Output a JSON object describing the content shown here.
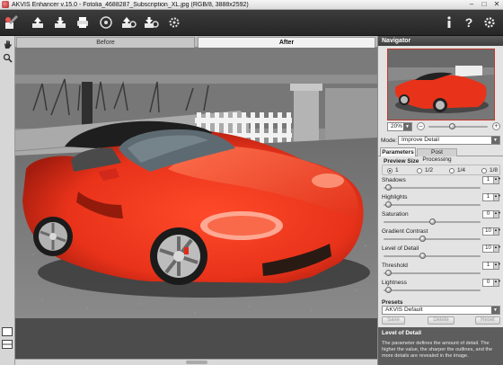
{
  "window": {
    "title": "AKVIS Enhancer v.15.0 - Fotolia_4688287_Subscription_XL.jpg (RGB/8, 3888x2592)",
    "controls": [
      "–",
      "□",
      "✕"
    ]
  },
  "toolbar": {
    "left_icons": [
      "brush-icon",
      "open-icon",
      "save-icon",
      "print-icon",
      "share-icon",
      "batch-icon",
      "batch-run-icon",
      "settings-icon"
    ],
    "right_icons": [
      "info-icon",
      "help-icon",
      "preferences-icon"
    ]
  },
  "left_tools": [
    "hand-icon",
    "zoom-icon",
    "view-mode-single-icon",
    "view-mode-split-icon"
  ],
  "tabs": {
    "before": "Before",
    "after": "After"
  },
  "navigator": {
    "title": "Navigator",
    "zoom": "20%",
    "minus": "–",
    "plus": "+"
  },
  "mode": {
    "label": "Mode:",
    "value": "Improve Detail"
  },
  "param_tabs": {
    "parameters": "Parameters",
    "post_processing": "Post Processing"
  },
  "preview_size": {
    "title": "Preview Size",
    "options": [
      "1",
      "1/2",
      "1/4",
      "1/8"
    ],
    "selected": "1"
  },
  "params": [
    {
      "label": "Shadows",
      "value": "1",
      "level": 0.05
    },
    {
      "label": "Highlights",
      "value": "1",
      "level": 0.05
    },
    {
      "label": "Saturation",
      "value": "0",
      "level": 0.5
    },
    {
      "label": "Gradient Contrast",
      "value": "10",
      "level": 0.4
    },
    {
      "label": "Level of Detail",
      "value": "10",
      "level": 0.4
    },
    {
      "label": "Threshold",
      "value": "1",
      "level": 0.05
    },
    {
      "label": "Lightness",
      "value": "0",
      "level": 0.05
    }
  ],
  "presets": {
    "title": "Presets",
    "value": "AKVIS Default",
    "save": "Save",
    "delete": "Delete",
    "reset": "Reset"
  },
  "help": {
    "title": "Level of Detail",
    "text": "The parameter defines the amount of detail. The higher the value, the sharper the outlines, and the more details are revealed in the image."
  }
}
